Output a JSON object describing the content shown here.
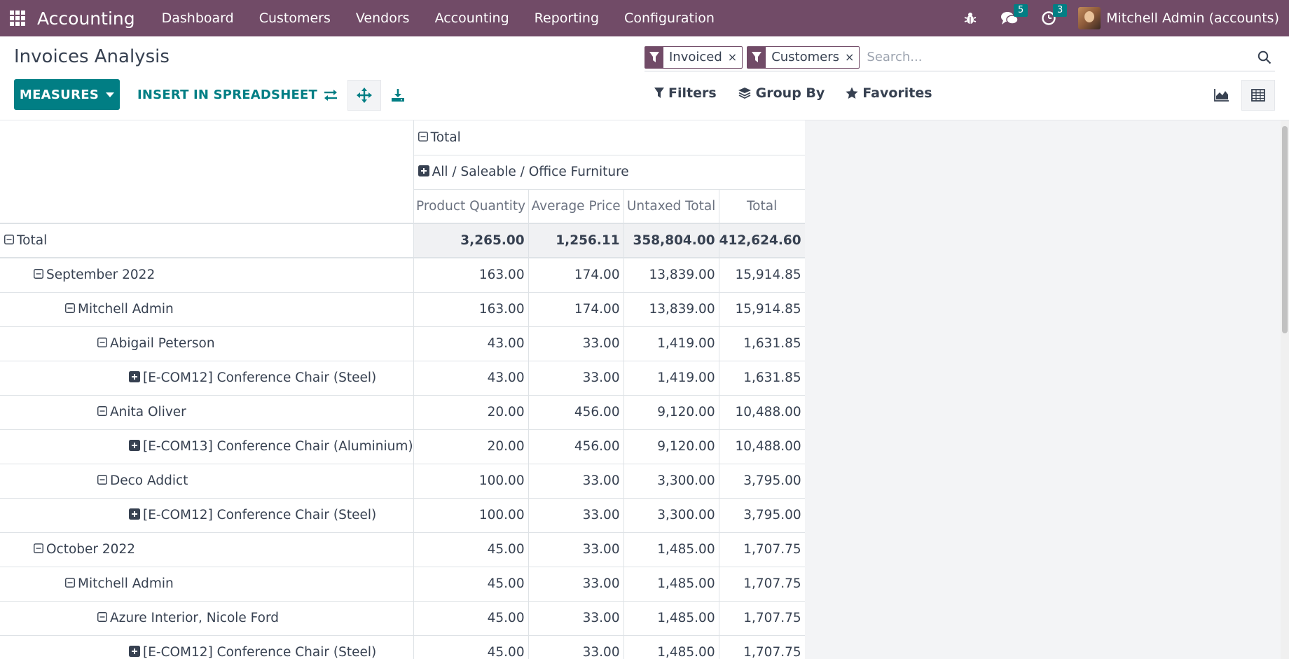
{
  "navbar": {
    "brand": "Accounting",
    "menu": [
      "Dashboard",
      "Customers",
      "Vendors",
      "Accounting",
      "Reporting",
      "Configuration"
    ],
    "messages_count": "5",
    "activities_count": "3",
    "user_name": "Mitchell Admin (accounts)"
  },
  "control": {
    "title": "Invoices Analysis",
    "measures_label": "MEASURES",
    "insert_label": "INSERT IN SPREADSHEET",
    "facets": [
      "Invoiced",
      "Customers"
    ],
    "search_placeholder": "Search...",
    "filters_label": "Filters",
    "groupby_label": "Group By",
    "favorites_label": "Favorites"
  },
  "pivot": {
    "col_header_total": "Total",
    "col_header_group": "All / Saleable / Office Furniture",
    "measures": [
      "Product Quantity",
      "Average Price",
      "Untaxed Total",
      "Total"
    ],
    "rows": [
      {
        "label": "Total",
        "level": 0,
        "toggle": "minus",
        "values": [
          "3,265.00",
          "1,256.11",
          "358,804.00",
          "412,624.60"
        ],
        "total": true
      },
      {
        "label": "September 2022",
        "level": 1,
        "toggle": "minus",
        "values": [
          "163.00",
          "174.00",
          "13,839.00",
          "15,914.85"
        ]
      },
      {
        "label": "Mitchell Admin",
        "level": 2,
        "toggle": "minus",
        "values": [
          "163.00",
          "174.00",
          "13,839.00",
          "15,914.85"
        ]
      },
      {
        "label": "Abigail Peterson",
        "level": 3,
        "toggle": "minus",
        "values": [
          "43.00",
          "33.00",
          "1,419.00",
          "1,631.85"
        ]
      },
      {
        "label": "[E-COM12] Conference Chair (Steel)",
        "level": 4,
        "toggle": "plus",
        "values": [
          "43.00",
          "33.00",
          "1,419.00",
          "1,631.85"
        ]
      },
      {
        "label": "Anita Oliver",
        "level": 3,
        "toggle": "minus",
        "values": [
          "20.00",
          "456.00",
          "9,120.00",
          "10,488.00"
        ]
      },
      {
        "label": "[E-COM13] Conference Chair (Aluminium)",
        "level": 4,
        "toggle": "plus",
        "values": [
          "20.00",
          "456.00",
          "9,120.00",
          "10,488.00"
        ]
      },
      {
        "label": "Deco Addict",
        "level": 3,
        "toggle": "minus",
        "values": [
          "100.00",
          "33.00",
          "3,300.00",
          "3,795.00"
        ]
      },
      {
        "label": "[E-COM12] Conference Chair (Steel)",
        "level": 4,
        "toggle": "plus",
        "values": [
          "100.00",
          "33.00",
          "3,300.00",
          "3,795.00"
        ]
      },
      {
        "label": "October 2022",
        "level": 1,
        "toggle": "minus",
        "values": [
          "45.00",
          "33.00",
          "1,485.00",
          "1,707.75"
        ]
      },
      {
        "label": "Mitchell Admin",
        "level": 2,
        "toggle": "minus",
        "values": [
          "45.00",
          "33.00",
          "1,485.00",
          "1,707.75"
        ]
      },
      {
        "label": "Azure Interior, Nicole Ford",
        "level": 3,
        "toggle": "minus",
        "values": [
          "45.00",
          "33.00",
          "1,485.00",
          "1,707.75"
        ]
      },
      {
        "label": "[E-COM12] Conference Chair (Steel)",
        "level": 4,
        "toggle": "plus",
        "values": [
          "45.00",
          "33.00",
          "1,485.00",
          "1,707.75"
        ]
      }
    ]
  },
  "colors": {
    "navbar": "#714b67",
    "accent": "#017e84",
    "text": "#374151",
    "muted": "#6b7280"
  }
}
